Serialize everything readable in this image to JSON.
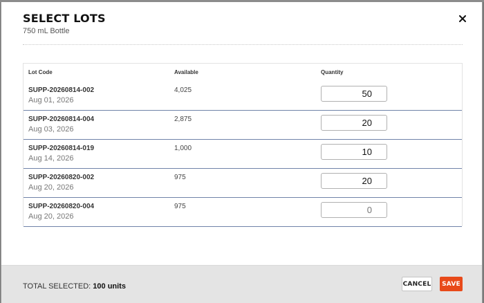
{
  "modal": {
    "title": "SELECT LOTS",
    "subtitle": "750 mL Bottle",
    "close_icon": "close-icon"
  },
  "table": {
    "headers": {
      "lot_code": "Lot Code",
      "available": "Available",
      "quantity": "Quantity"
    },
    "rows": [
      {
        "lot_code": "SUPP-20260814-002",
        "date": "Aug 01, 2026",
        "available": "4,025",
        "quantity": "50",
        "placeholder": ""
      },
      {
        "lot_code": "SUPP-20260814-004",
        "date": "Aug 03, 2026",
        "available": "2,875",
        "quantity": "20",
        "placeholder": ""
      },
      {
        "lot_code": "SUPP-20260814-019",
        "date": "Aug 14, 2026",
        "available": "1,000",
        "quantity": "10",
        "placeholder": ""
      },
      {
        "lot_code": "SUPP-20260820-002",
        "date": "Aug 20, 2026",
        "available": "975",
        "quantity": "20",
        "placeholder": ""
      },
      {
        "lot_code": "SUPP-20260820-004",
        "date": "Aug 20, 2026",
        "available": "975",
        "quantity": "",
        "placeholder": "0"
      }
    ]
  },
  "footer": {
    "total_label": "TOTAL SELECTED:",
    "total_value": "100 units",
    "cancel_label": "CANCEL",
    "save_label": "SAVE"
  },
  "colors": {
    "accent": "#e84a1a",
    "row_divider": "#6f82a8",
    "footer_bg": "#e4e4e4"
  }
}
